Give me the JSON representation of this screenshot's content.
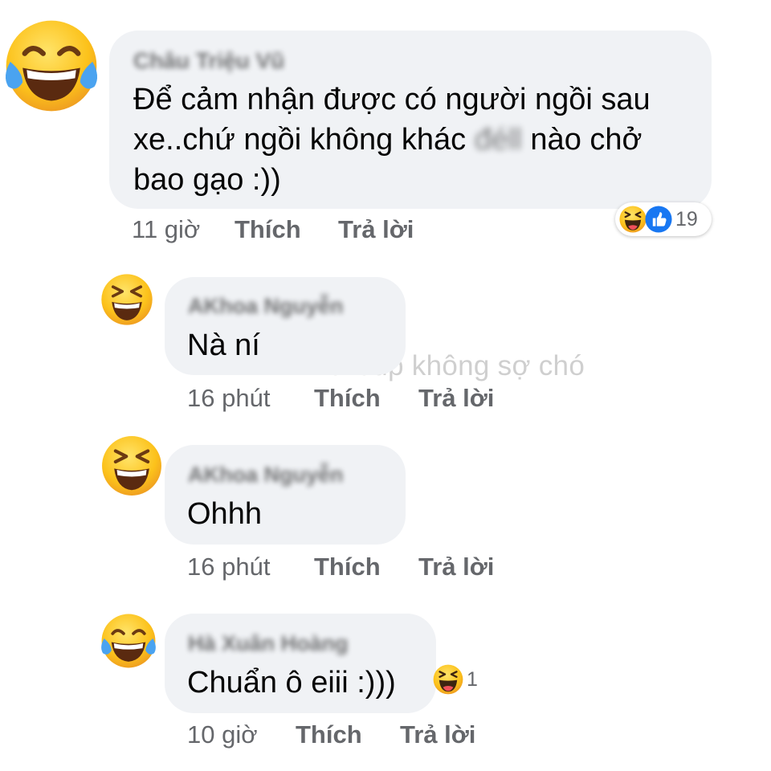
{
  "watermark": "Group không sợ chó",
  "comments": [
    {
      "author": "Châu Triệu Vũ",
      "avatar_icon": "tears-of-joy-emoji-icon",
      "text_line1": "Để cảm nhận được có người ngồi sau",
      "text_line2_a": "xe..chứ ngồi không khác",
      "text_line2_censored": "đéll",
      "text_line2_b": "nào chở",
      "text_line3": "bao gạo :))",
      "time": "11 giờ",
      "like_label": "Thích",
      "reply_label": "Trả lời",
      "reaction_count": "19",
      "reaction_icons": [
        "haha-reaction-icon",
        "like-reaction-icon"
      ]
    },
    {
      "author": "AKhoa Nguyễn",
      "avatar_icon": "grinning-squinting-emoji-icon",
      "text": "Nà ní",
      "time": "16 phút",
      "like_label": "Thích",
      "reply_label": "Trả lời"
    },
    {
      "author": "AKhoa Nguyễn",
      "avatar_icon": "grinning-squinting-emoji-icon",
      "text": "Ohhh",
      "time": "16 phút",
      "like_label": "Thích",
      "reply_label": "Trả lời"
    },
    {
      "author": "Hà Xuân Hoàng",
      "avatar_icon": "tears-of-joy-emoji-icon",
      "text": "Chuẩn ô eiii :)))",
      "time": "10 giờ",
      "like_label": "Thích",
      "reply_label": "Trả lời",
      "reaction_count": "1",
      "reaction_icons": [
        "haha-reaction-icon"
      ]
    }
  ],
  "colors": {
    "bubble": "#f0f2f5",
    "meta_text": "#65676b",
    "emoji_yellow": "#fcc21b",
    "like_blue": "#1877f2"
  }
}
